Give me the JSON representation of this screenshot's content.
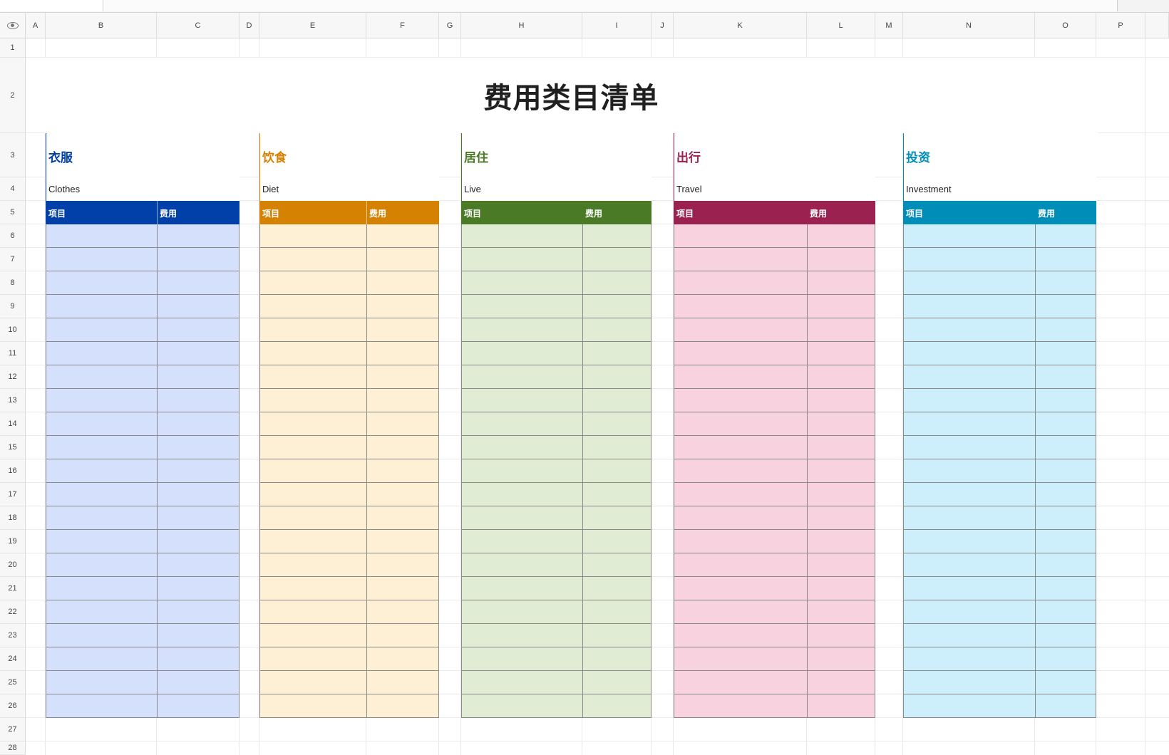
{
  "title": "费用类目清单",
  "columns": [
    "A",
    "B",
    "C",
    "D",
    "E",
    "F",
    "G",
    "H",
    "I",
    "J",
    "K",
    "L",
    "M",
    "N",
    "O",
    "P"
  ],
  "rows": [
    "1",
    "2",
    "3",
    "4",
    "5",
    "6",
    "7",
    "8",
    "9",
    "10",
    "11",
    "12",
    "13",
    "14",
    "15",
    "16",
    "17",
    "18",
    "19",
    "20",
    "21",
    "22",
    "23",
    "24",
    "25",
    "26",
    "27",
    "28"
  ],
  "blocks": [
    {
      "zh": "衣服",
      "en": "Clothes",
      "col1": "项目",
      "col2": "费用",
      "accent": "#0040a8",
      "fill": "#d4e0fc"
    },
    {
      "zh": "饮食",
      "en": "Diet",
      "col1": "项目",
      "col2": "费用",
      "accent": "#d58203",
      "fill": "#fef0d4"
    },
    {
      "zh": "居住",
      "en": "Live",
      "col1": "项目",
      "col2": "费用",
      "accent": "#4b7a27",
      "fill": "#e0ecd4"
    },
    {
      "zh": "出行",
      "en": "Travel",
      "col1": "项目",
      "col2": "费用",
      "accent": "#9b2250",
      "fill": "#f8d3df"
    },
    {
      "zh": "投资",
      "en": "Investment",
      "col1": "项目",
      "col2": "费用",
      "accent": "#008db8",
      "fill": "#cdeffc"
    }
  ],
  "body_rows": 21,
  "icons": {
    "corner": "eye-icon"
  }
}
